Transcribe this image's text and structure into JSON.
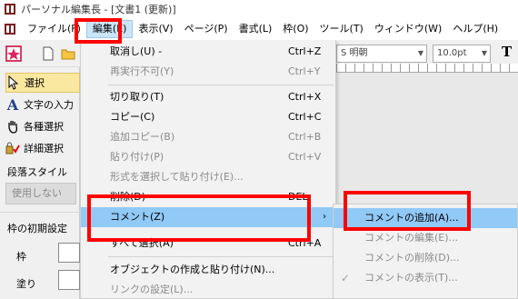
{
  "window": {
    "title": "パーソナル編集長 - [文書1 (更新)]"
  },
  "menubar": {
    "items": [
      "ファイル(F)",
      "編集(E)",
      "表示(V)",
      "ページ(P)",
      "書式(L)",
      "枠(O)",
      "ツール(T)",
      "ウィンドウ(W)",
      "ヘルプ(H)"
    ]
  },
  "toolbar": {
    "font_value": "S 明朝",
    "size_value": "10.0pt"
  },
  "left_panel": {
    "tools": [
      "選択",
      "文字の入力",
      "各種選択",
      "詳細選択"
    ],
    "paragraph_style_label": "段落スタイル",
    "paragraph_style_value": "使用しない",
    "frame_initial_label": "枠の初期設定",
    "frame_label": "枠",
    "fill_label": "塗り"
  },
  "edit_menu": {
    "items": [
      {
        "label": "取消し(U) -",
        "shortcut": "Ctrl+Z",
        "disabled": false
      },
      {
        "label": "再実行不可(Y)",
        "shortcut": "Ctrl+Y",
        "disabled": true
      },
      {
        "label": "切り取り(T)",
        "shortcut": "Ctrl+X",
        "disabled": false
      },
      {
        "label": "コピー(C)",
        "shortcut": "Ctrl+C",
        "disabled": false
      },
      {
        "label": "追加コピー(B)",
        "shortcut": "Ctrl+B",
        "disabled": true
      },
      {
        "label": "貼り付け(P)",
        "shortcut": "Ctrl+V",
        "disabled": true
      },
      {
        "label": "形式を選択して貼り付け(E)...",
        "shortcut": "",
        "disabled": true
      },
      {
        "label": "削除(D)",
        "shortcut": "DEL",
        "disabled": false
      },
      {
        "label": "コメント(Z)",
        "shortcut": "",
        "disabled": false
      },
      {
        "label": "すべて選択(A)",
        "shortcut": "Ctrl+A",
        "disabled": false
      },
      {
        "label": "オブジェクトの作成と貼り付け(N)...",
        "shortcut": "",
        "disabled": false
      },
      {
        "label": "リンクの設定(L)...",
        "shortcut": "",
        "disabled": true
      }
    ]
  },
  "comment_submenu": {
    "items": [
      {
        "label": "コメントの追加(A)...",
        "disabled": false
      },
      {
        "label": "コメントの編集(E)...",
        "disabled": true
      },
      {
        "label": "コメントの削除(D)...",
        "disabled": true
      },
      {
        "label": "コメントの表示(T)...",
        "disabled": true
      }
    ]
  },
  "colors": {
    "highlight": "#91c9f7",
    "annotation_red": "#ff0000",
    "selected_tool": "#fbe8a0"
  }
}
